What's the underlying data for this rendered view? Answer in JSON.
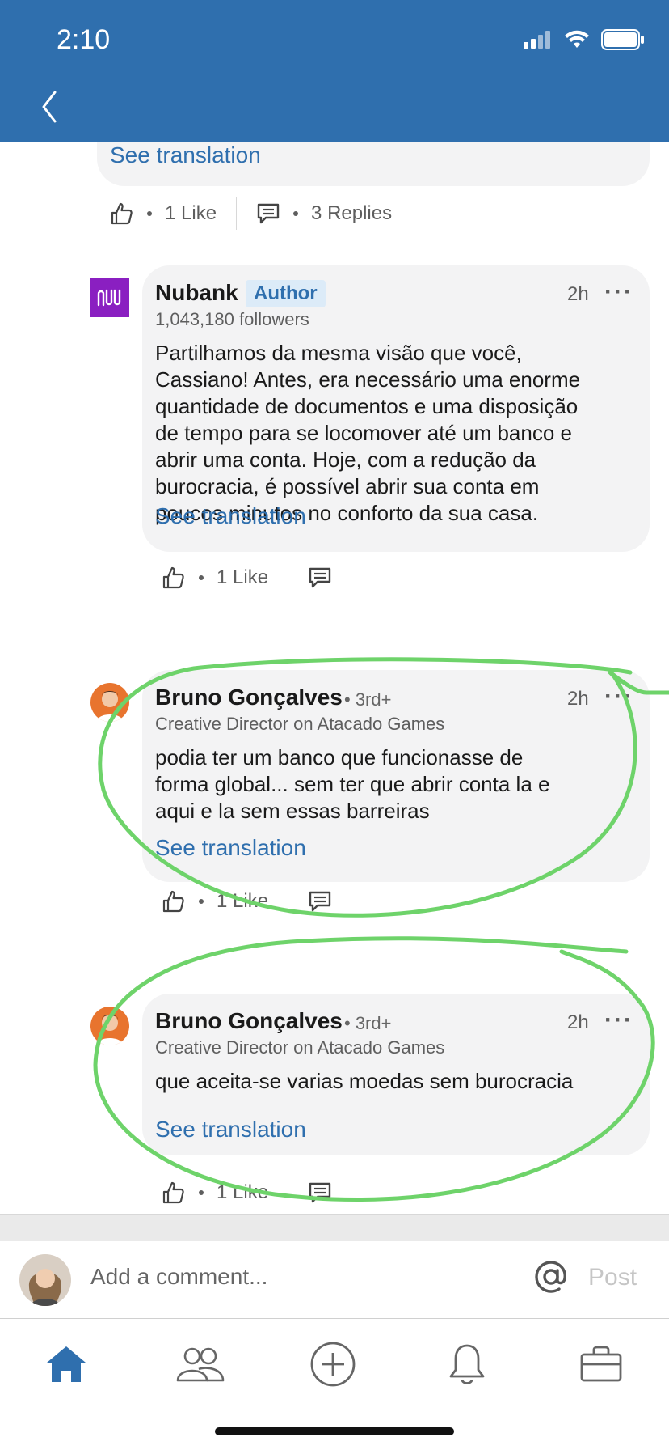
{
  "status_bar": {
    "time": "2:10"
  },
  "colors": {
    "header_bg": "#2f6fae",
    "link": "#2f6fae",
    "bubble_bg": "#f3f3f4",
    "annotation": "#6ed36a"
  },
  "previous_comment": {
    "see_translation": "See translation",
    "likes": "1 Like",
    "replies": "3 Replies"
  },
  "comments": [
    {
      "name": "Nubank",
      "badge": "Author",
      "subtitle": "1,043,180 followers",
      "time": "2h",
      "more": "···",
      "body": [
        "Partilhamos da mesma visão que você,",
        "Cassiano! Antes, era necessário uma enorme",
        "quantidade de documentos e uma disposição",
        "de tempo para se locomover até um banco e",
        "abrir uma conta. Hoje, com a redução da",
        "burocracia, é possível abrir sua conta em",
        "poucos minutos no conforto da sua casa."
      ],
      "see_translation": "See translation",
      "likes": "1 Like",
      "avatar_icon": "nubank-logo-icon"
    },
    {
      "name": "Bruno Gonçalves",
      "degree": "• 3rd+",
      "subtitle": "Creative Director on Atacado Games",
      "time": "2h",
      "more": "···",
      "body": [
        "podia ter um banco que funcionasse de",
        "forma global... sem ter que abrir conta la e",
        "aqui e la sem essas barreiras"
      ],
      "see_translation": "See translation",
      "likes": "1 Like"
    },
    {
      "name": "Bruno Gonçalves",
      "degree": "• 3rd+",
      "subtitle": "Creative Director on Atacado Games",
      "time": "2h",
      "more": "···",
      "body": [
        "que aceita-se varias moedas sem burocracia"
      ],
      "see_translation": "See translation",
      "likes": "1 Like"
    }
  ],
  "composer": {
    "placeholder": "Add a comment...",
    "post_label": "Post"
  },
  "bottom_nav": [
    "home-icon",
    "my-network-icon",
    "post-icon",
    "notifications-icon",
    "jobs-icon"
  ]
}
